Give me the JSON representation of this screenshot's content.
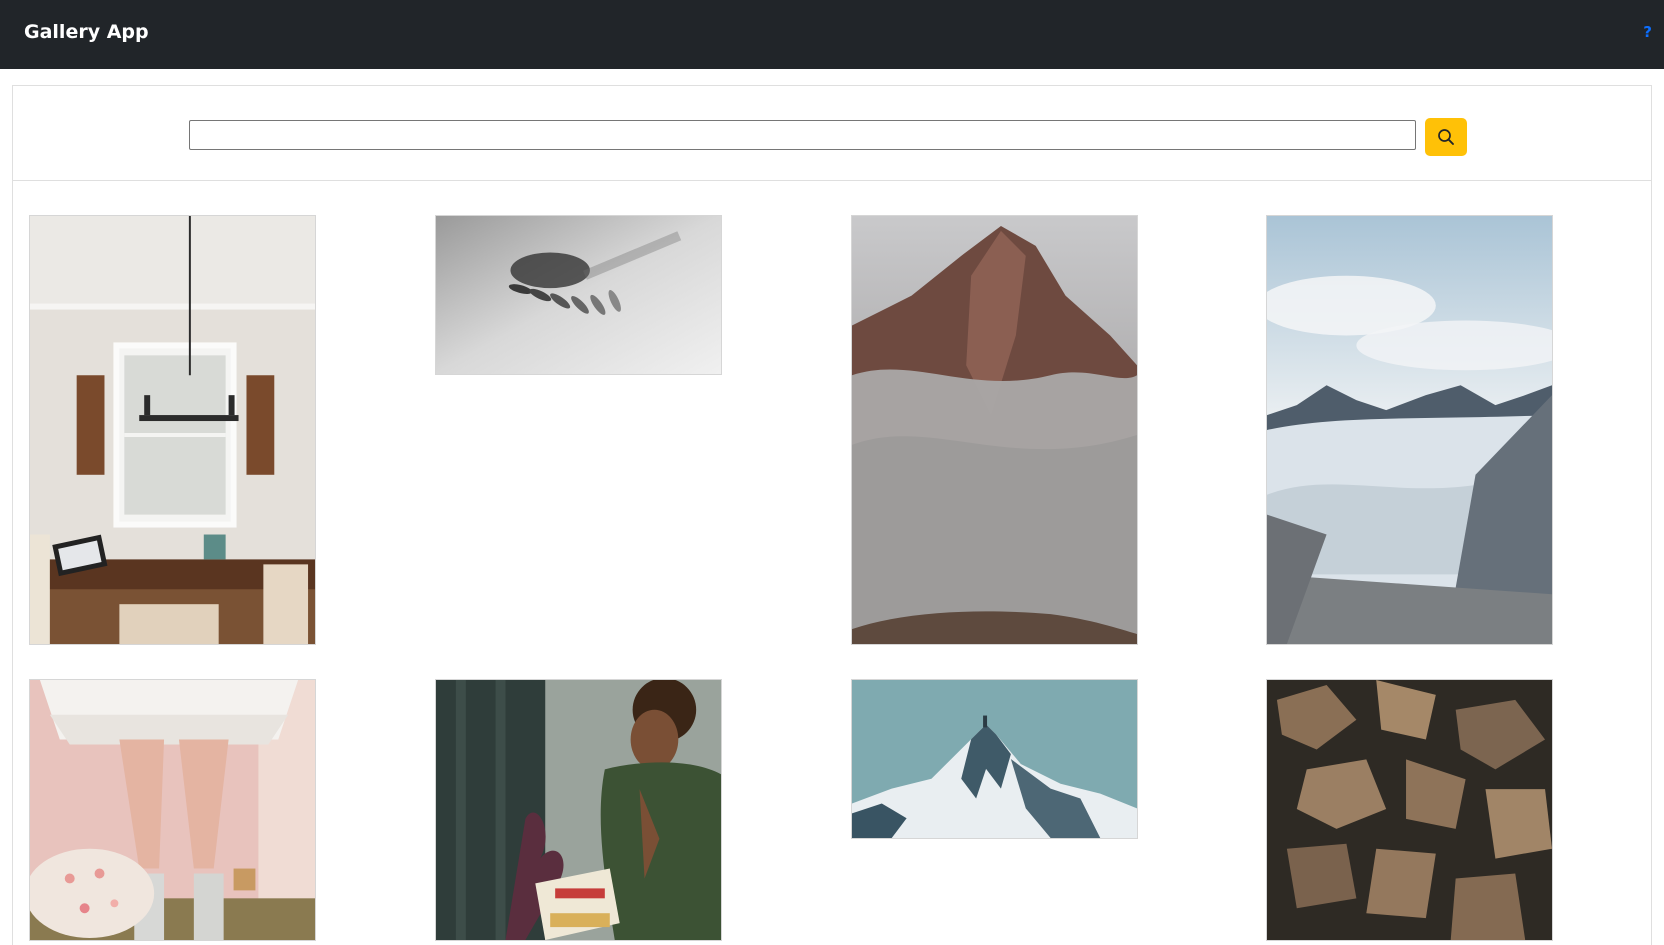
{
  "app": {
    "title": "Gallery App",
    "help_label": "?"
  },
  "search": {
    "value": "",
    "placeholder": "",
    "button_icon": "search-icon"
  },
  "colors": {
    "navbar": "#212529",
    "accent": "#ffc107",
    "link": "#0d6efd"
  },
  "gallery": {
    "images": [
      {
        "subject": "dining-room",
        "icon": "photo-icon"
      },
      {
        "subject": "spoons-shadow",
        "icon": "photo-icon"
      },
      {
        "subject": "misty-mountain",
        "icon": "photo-icon"
      },
      {
        "subject": "glacier-valley",
        "icon": "photo-icon"
      },
      {
        "subject": "tutu-flowers",
        "icon": "photo-icon"
      },
      {
        "subject": "woman-reading",
        "icon": "photo-icon"
      },
      {
        "subject": "snowy-peak",
        "icon": "photo-icon"
      },
      {
        "subject": "rocky-cliff",
        "icon": "photo-icon"
      }
    ]
  }
}
